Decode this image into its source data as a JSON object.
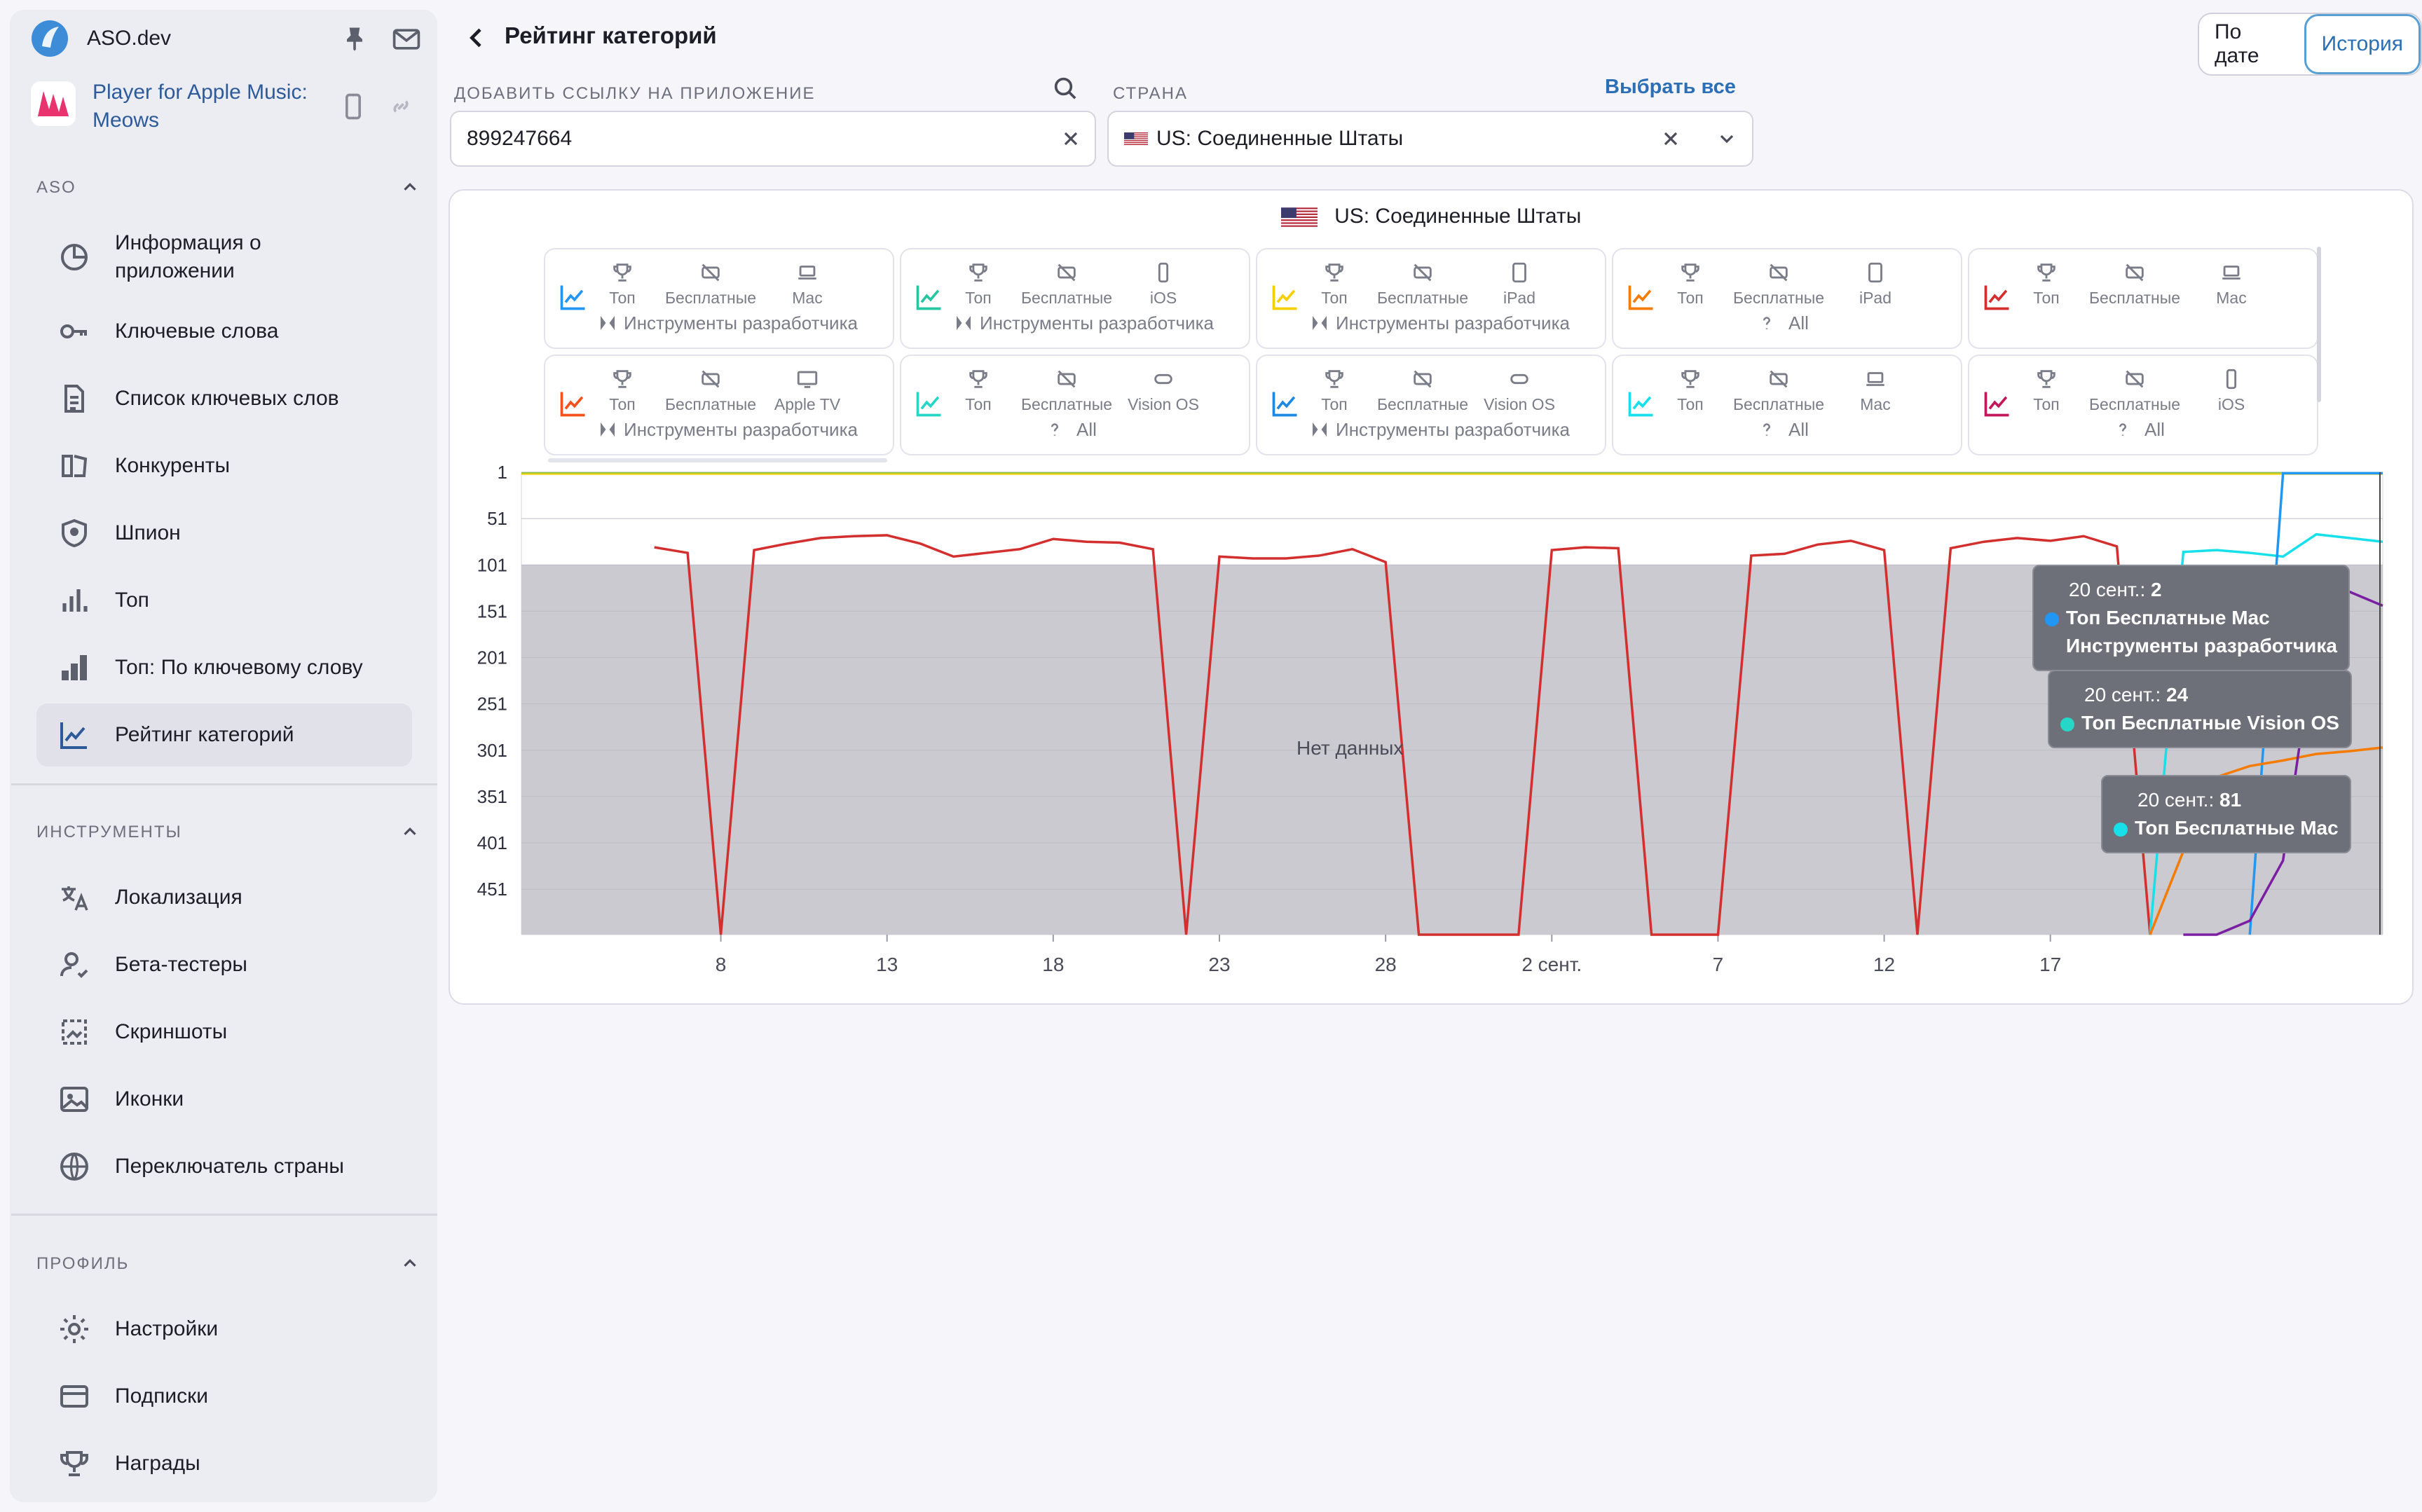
{
  "app": {
    "name": "ASO.dev"
  },
  "selected_app": {
    "title": "Player for Apple Music: Meows"
  },
  "sidebar": {
    "section_aso": "ASO",
    "aso_items": [
      {
        "label": "Информация о приложении",
        "icon": "pie-chart-icon"
      },
      {
        "label": "Ключевые слова",
        "icon": "key-icon"
      },
      {
        "label": "Список ключевых слов",
        "icon": "document-list-icon"
      },
      {
        "label": "Конкуренты",
        "icon": "competitors-icon"
      },
      {
        "label": "Шпион",
        "icon": "shield-spy-icon"
      },
      {
        "label": "Топ",
        "icon": "bar-chart-icon"
      },
      {
        "label": "Топ: По ключевому слову",
        "icon": "bar-chart-filled-icon"
      },
      {
        "label": "Рейтинг категорий",
        "icon": "line-chart-icon",
        "active": true
      }
    ],
    "section_tools": "ИНСТРУМЕНТЫ",
    "tool_items": [
      {
        "label": "Локализация",
        "icon": "translate-icon"
      },
      {
        "label": "Бета-тестеры",
        "icon": "user-check-icon"
      },
      {
        "label": "Скриншоты",
        "icon": "screenshot-icon"
      },
      {
        "label": "Иконки",
        "icon": "image-icon"
      },
      {
        "label": "Переключатель страны",
        "icon": "globe-icon"
      }
    ],
    "section_profile": "ПРОФИЛЬ",
    "profile_items": [
      {
        "label": "Настройки",
        "icon": "gear-icon"
      },
      {
        "label": "Подписки",
        "icon": "card-icon"
      },
      {
        "label": "Награды",
        "icon": "trophy-icon"
      }
    ]
  },
  "header": {
    "title": "Рейтинг категорий",
    "toggle_date": "По дате",
    "toggle_history": "История"
  },
  "filters": {
    "app_link_label": "ДОБАВИТЬ ССЫЛКУ НА ПРИЛОЖЕНИЕ",
    "app_link_value": "899247664",
    "country_label": "СТРАНА",
    "select_all": "Выбрать все",
    "country_value": "US: Соединенные Штаты"
  },
  "chart_panel": {
    "country": "US: Соединенные Штаты",
    "no_data": "Нет данных"
  },
  "category_cards": [
    {
      "color": "#2196f3",
      "a": "Топ",
      "b": "Бесплатные",
      "c": "Mac",
      "c_icon": "laptop-icon",
      "line2": "Инструменты разработчика",
      "line2_icon": "xcode-icon"
    },
    {
      "color": "#26c6a0",
      "a": "Топ",
      "b": "Бесплатные",
      "c": "iOS",
      "c_icon": "phone-icon",
      "line2": "Инструменты разработчика",
      "line2_icon": "xcode-icon"
    },
    {
      "color": "#f5d000",
      "a": "Топ",
      "b": "Бесплатные",
      "c": "iPad",
      "c_icon": "tablet-icon",
      "line2": "Инструменты разработчика",
      "line2_icon": "xcode-icon"
    },
    {
      "color": "#f57c00",
      "a": "Топ",
      "b": "Бесплатные",
      "c": "iPad",
      "c_icon": "tablet-icon",
      "line2": "All",
      "line2_icon": "question-icon"
    },
    {
      "color": "#d32f2f",
      "a": "Топ",
      "b": "Бесплатные",
      "c": "Mac",
      "c_icon": "laptop-icon",
      "line2": "",
      "line2_icon": ""
    },
    {
      "color": "#f4511e",
      "a": "Топ",
      "b": "Бесплатные",
      "c": "Apple TV",
      "c_icon": "tv-icon",
      "line2": "Инструменты разработчика",
      "line2_icon": "xcode-icon"
    },
    {
      "color": "#26d6c6",
      "a": "Топ",
      "b": "Бесплатные",
      "c": "Vision OS",
      "c_icon": "vision-icon",
      "line2": "All",
      "line2_icon": "question-icon"
    },
    {
      "color": "#1e88e5",
      "a": "Топ",
      "b": "Бесплатные",
      "c": "Vision OS",
      "c_icon": "vision-icon",
      "line2": "Инструменты разработчика",
      "line2_icon": "xcode-icon"
    },
    {
      "color": "#18e0ea",
      "a": "Топ",
      "b": "Бесплатные",
      "c": "Mac",
      "c_icon": "laptop-icon",
      "line2": "All",
      "line2_icon": "question-icon"
    },
    {
      "color": "#c2185b",
      "a": "Топ",
      "b": "Бесплатные",
      "c": "iOS",
      "c_icon": "phone-icon",
      "line2": "All",
      "line2_icon": "question-icon"
    }
  ],
  "chart_data": {
    "type": "line",
    "y_reversed": true,
    "ylim": [
      1,
      500
    ],
    "yticks": [
      "1",
      "51",
      "101",
      "151",
      "201",
      "251",
      "301",
      "351",
      "401",
      "451"
    ],
    "xticks": [
      "8",
      "13",
      "18",
      "23",
      "28",
      "2 сент.",
      "7",
      "12",
      "17"
    ],
    "x_range": [
      3,
      20
    ],
    "grid": true,
    "nodata_band": [
      101,
      500
    ],
    "series": [
      {
        "name": "Топ Бесплатные Mac",
        "color": "#d32f2f",
        "points": [
          [
            3,
            82
          ],
          [
            4,
            88
          ],
          [
            5,
            500
          ],
          [
            6,
            85
          ],
          [
            7,
            78
          ],
          [
            8,
            72
          ],
          [
            9,
            70
          ],
          [
            10,
            69
          ],
          [
            11,
            78
          ],
          [
            12,
            92
          ],
          [
            13,
            88
          ],
          [
            14,
            84
          ],
          [
            15,
            73
          ],
          [
            16,
            76
          ],
          [
            17,
            77
          ],
          [
            18,
            84
          ],
          [
            19,
            500
          ],
          [
            20,
            92
          ],
          [
            21,
            94
          ],
          [
            22,
            94
          ],
          [
            23,
            91
          ],
          [
            24,
            84
          ],
          [
            25,
            98
          ],
          [
            26,
            500
          ],
          [
            29,
            500
          ],
          [
            30,
            85
          ],
          [
            31,
            82
          ],
          [
            32,
            83
          ],
          [
            33,
            500
          ],
          [
            35,
            500
          ],
          [
            36,
            91
          ],
          [
            37,
            89
          ],
          [
            38,
            79
          ],
          [
            39,
            75
          ],
          [
            40,
            85
          ],
          [
            41,
            500
          ],
          [
            42,
            83
          ],
          [
            43,
            76
          ],
          [
            44,
            72
          ],
          [
            45,
            75
          ],
          [
            46,
            70
          ],
          [
            47,
            81
          ],
          [
            48,
            500
          ]
        ]
      },
      {
        "name": "Топ Бесплатные Vision OS",
        "color": "#18e0ea",
        "points": [
          [
            48,
            500
          ],
          [
            49,
            87
          ],
          [
            50,
            85
          ],
          [
            51,
            88
          ],
          [
            52,
            92
          ],
          [
            53,
            68
          ],
          [
            54,
            72
          ],
          [
            55,
            76
          ]
        ]
      },
      {
        "name": "Топ Бесплатные Mac Инструменты разработчика",
        "color": "#2196f3",
        "points": [
          [
            51,
            500
          ],
          [
            52,
            2
          ],
          [
            53,
            2
          ],
          [
            54,
            2
          ],
          [
            55,
            2
          ]
        ]
      },
      {
        "name": "",
        "color": "#f57c00",
        "points": [
          [
            48,
            500
          ],
          [
            49,
            410
          ],
          [
            50,
            330
          ],
          [
            51,
            318
          ],
          [
            52,
            312
          ],
          [
            53,
            305
          ],
          [
            54,
            302
          ],
          [
            55,
            298
          ]
        ]
      },
      {
        "name": "",
        "color": "#7b1fa2",
        "points": [
          [
            49,
            500
          ],
          [
            50,
            500
          ],
          [
            51,
            485
          ],
          [
            52,
            420
          ],
          [
            53,
            170
          ],
          [
            54,
            130
          ],
          [
            55,
            145
          ]
        ]
      }
    ],
    "tooltips": [
      {
        "date": "20 сент.:",
        "value": "2",
        "series": "Топ Бесплатные Mac",
        "series2": "Инструменты разработчика",
        "color": "#2196f3"
      },
      {
        "date": "20 сент.:",
        "value": "24",
        "series": "Топ Бесплатные Vision OS",
        "color": "#26d6c6"
      },
      {
        "date": "20 сент.:",
        "value": "81",
        "series": "Топ Бесплатные Mac",
        "color": "#18e0ea"
      }
    ]
  }
}
